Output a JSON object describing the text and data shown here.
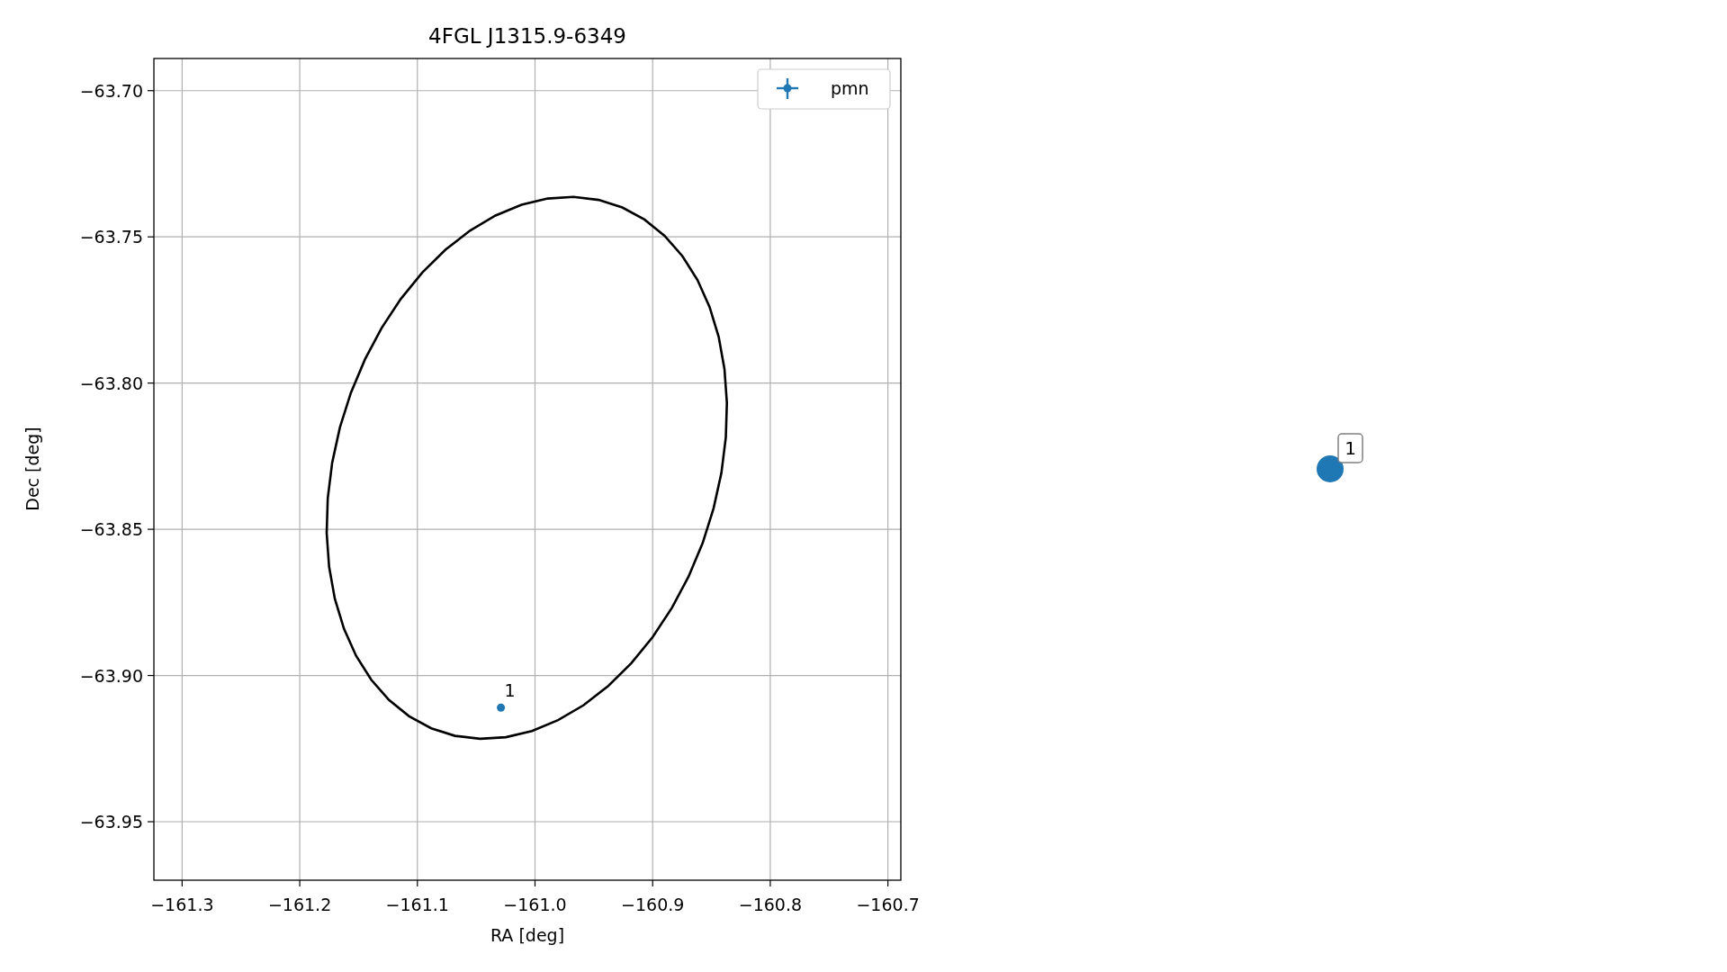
{
  "plot": {
    "chart_data": {
      "type": "scatter",
      "title": "4FGL J1315.9-6349",
      "xlabel": "RA [deg]",
      "ylabel": "Dec [deg]",
      "grid": true,
      "xlim": [
        -161.324,
        -160.689
      ],
      "ylim": [
        -63.97,
        -63.689
      ],
      "xticks": [
        {
          "value": -161.3,
          "label": "−161.3"
        },
        {
          "value": -161.2,
          "label": "−161.2"
        },
        {
          "value": -161.1,
          "label": "−161.1"
        },
        {
          "value": -161.0,
          "label": "−161.0"
        },
        {
          "value": -160.9,
          "label": "−160.9"
        },
        {
          "value": -160.8,
          "label": "−160.8"
        },
        {
          "value": -160.7,
          "label": "−160.7"
        }
      ],
      "yticks": [
        {
          "value": -63.7,
          "label": "−63.70"
        },
        {
          "value": -63.75,
          "label": "−63.75"
        },
        {
          "value": -63.8,
          "label": "−63.80"
        },
        {
          "value": -63.85,
          "label": "−63.85"
        },
        {
          "value": -63.9,
          "label": "−63.90"
        },
        {
          "value": -63.95,
          "label": "−63.95"
        }
      ],
      "series": [
        {
          "name": "pmn",
          "color": "#1f77b4",
          "marker": "o",
          "x": [
            -161.029
          ],
          "values": [
            -63.911
          ]
        }
      ],
      "annotations": [
        {
          "x": -161.029,
          "y": -63.911,
          "text": "1"
        }
      ]
    }
  },
  "side_marker": {
    "label": "1",
    "color": "#1f77b4"
  }
}
